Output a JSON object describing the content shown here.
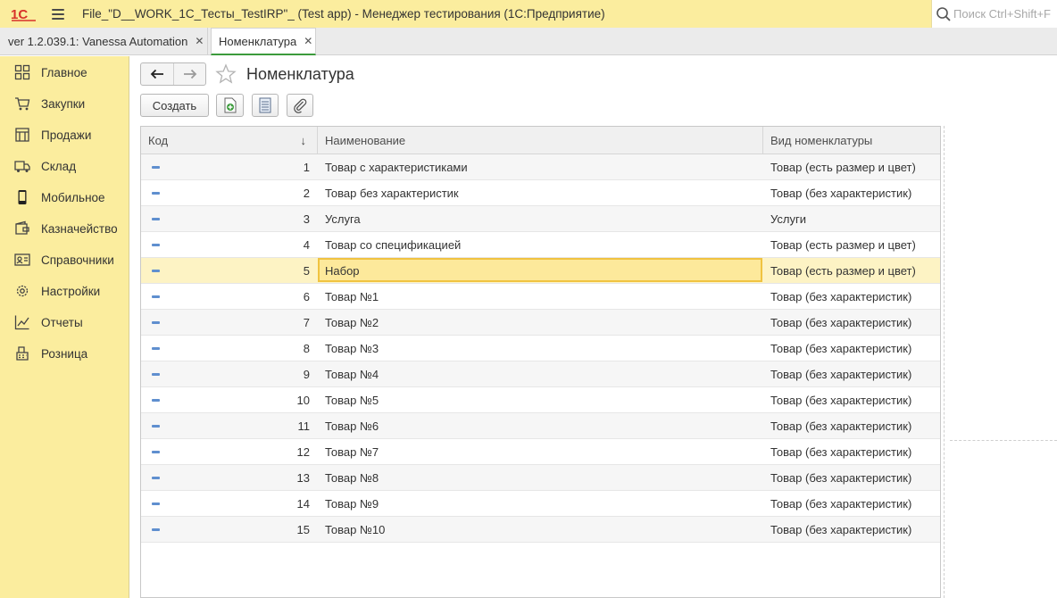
{
  "titlebar": {
    "logo": "1С",
    "title": "File_\"D__WORK_1C_Тесты_TestIRP\"_ (Test app)  - Менеджер тестирования (1С:Предприятие)",
    "search_placeholder": "Поиск Ctrl+Shift+F",
    "icons": [
      "1c-logo-icon",
      "menu-icon",
      "search-icon"
    ]
  },
  "tabs": [
    {
      "label": "ver 1.2.039.1: Vanessa Automation",
      "close": "✕"
    },
    {
      "label": "Номенклатура",
      "close": "✕",
      "active": true
    }
  ],
  "sidebar": {
    "items": [
      {
        "label": "Главное",
        "icon": "grid-icon"
      },
      {
        "label": "Закупки",
        "icon": "cart-icon"
      },
      {
        "label": "Продажи",
        "icon": "store-icon"
      },
      {
        "label": "Склад",
        "icon": "truck-icon"
      },
      {
        "label": "Мобильное",
        "icon": "phone-icon"
      },
      {
        "label": "Казначейство",
        "icon": "wallet-icon"
      },
      {
        "label": "Справочники",
        "icon": "id-card-icon"
      },
      {
        "label": "Настройки",
        "icon": "gear-icon"
      },
      {
        "label": "Отчеты",
        "icon": "chart-icon"
      },
      {
        "label": "Розница",
        "icon": "cash-register-icon"
      }
    ]
  },
  "page": {
    "title": "Номенклатура",
    "create_label": "Создать"
  },
  "table": {
    "columns": {
      "code": "Код",
      "name": "Наименование",
      "kind": "Вид номенклатуры"
    },
    "sort_indicator": "↓",
    "selected_row": 5,
    "rows": [
      {
        "code": "1",
        "name": "Товар с характеристиками",
        "kind": "Товар (есть размер и цвет)"
      },
      {
        "code": "2",
        "name": "Товар без характеристик",
        "kind": "Товар (без характеристик)"
      },
      {
        "code": "3",
        "name": "Услуга",
        "kind": "Услуги"
      },
      {
        "code": "4",
        "name": "Товар со спецификацией",
        "kind": "Товар (есть размер и цвет)"
      },
      {
        "code": "5",
        "name": "Набор",
        "kind": "Товар (есть размер и цвет)"
      },
      {
        "code": "6",
        "name": "Товар №1",
        "kind": "Товар (без характеристик)"
      },
      {
        "code": "7",
        "name": "Товар №2",
        "kind": "Товар (без характеристик)"
      },
      {
        "code": "8",
        "name": "Товар №3",
        "kind": "Товар (без характеристик)"
      },
      {
        "code": "9",
        "name": "Товар №4",
        "kind": "Товар (без характеристик)"
      },
      {
        "code": "10",
        "name": "Товар №5",
        "kind": "Товар (без характеристик)"
      },
      {
        "code": "11",
        "name": "Товар №6",
        "kind": "Товар (без характеристик)"
      },
      {
        "code": "12",
        "name": "Товар №7",
        "kind": "Товар (без характеристик)"
      },
      {
        "code": "13",
        "name": "Товар №8",
        "kind": "Товар (без характеристик)"
      },
      {
        "code": "14",
        "name": "Товар №9",
        "kind": "Товар (без характеристик)"
      },
      {
        "code": "15",
        "name": "Товар №10",
        "kind": "Товар (без характеристик)"
      }
    ]
  },
  "colors": {
    "panel_yellow": "#fbed9e",
    "selection": "#fdf3c4",
    "selection_border": "#f0c341",
    "active_tab_underline": "#3c9b3c"
  }
}
